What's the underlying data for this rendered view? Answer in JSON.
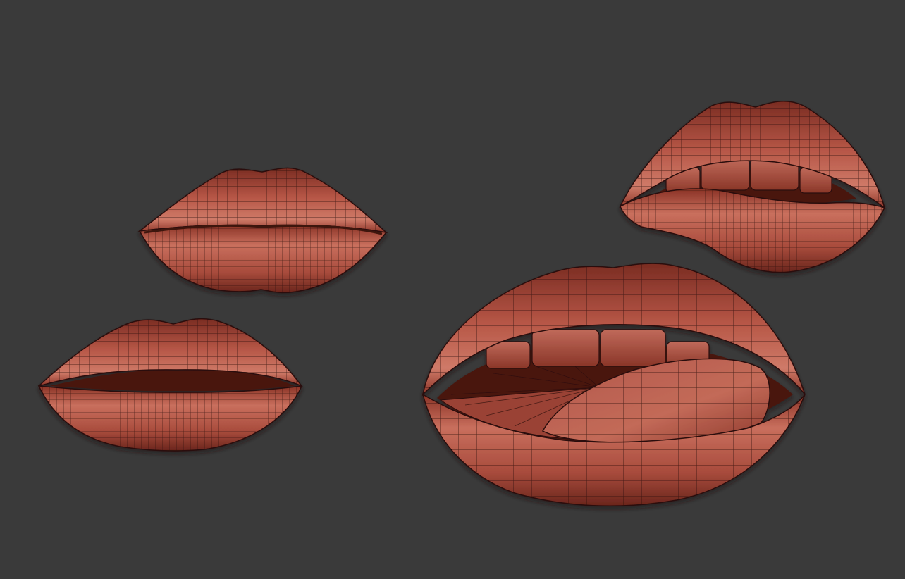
{
  "scene": {
    "background": "#3a3a3a",
    "material": {
      "base": "#a44a3c",
      "light": "#cf7a68",
      "dark": "#5e2119",
      "wire": "#2a0e0a",
      "mouth": "#4a1510",
      "teeth": "#b25848"
    },
    "models": [
      {
        "name": "closed-lips-small",
        "kind": "closed"
      },
      {
        "name": "parted-lips",
        "kind": "parted"
      },
      {
        "name": "lip-bite",
        "kind": "biting"
      },
      {
        "name": "open-mouth-tongue",
        "kind": "tongue"
      }
    ]
  }
}
